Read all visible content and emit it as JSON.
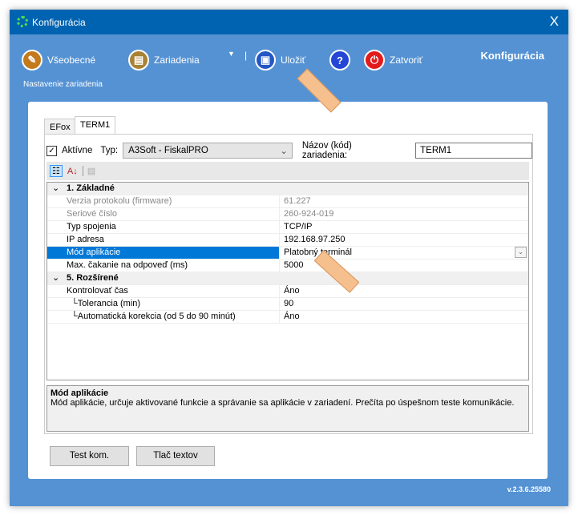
{
  "window": {
    "title": "Konfigurácia",
    "close": "X"
  },
  "toolbar": {
    "general": "Všeobecné",
    "devices": "Zariadenia",
    "save": "Uložiť",
    "help": "?",
    "close": "Zatvoriť",
    "header": "Konfigurácia",
    "subtitle": "Nastavenie zariadenia"
  },
  "tabs": [
    "EFox",
    "TERM1"
  ],
  "device": {
    "active_label": "Aktívne",
    "type_label": "Typ:",
    "type_value": "A3Soft - FiskalPRO",
    "name_label": "Názov (kód) zariadenia:",
    "name_value": "TERM1"
  },
  "grid": {
    "cat1": "1. Základné",
    "rows1": [
      {
        "name": "Verzia protokolu (firmware)",
        "value": "61.227"
      },
      {
        "name": "Seriové číslo",
        "value": "260-924-019"
      },
      {
        "name": "Typ spojenia",
        "value": "TCP/IP"
      },
      {
        "name": "IP adresa",
        "value": "192.168.97.250"
      },
      {
        "name": "Mód aplikácie",
        "value": "Platobný terminál"
      },
      {
        "name": "Max. čakanie na odpoveď (ms)",
        "value": "5000"
      }
    ],
    "cat2": "5. Rozšírené",
    "rows2": [
      {
        "name": "Kontrolovať čas",
        "value": "Áno"
      },
      {
        "name": "└Tolerancia (min)",
        "value": "90"
      },
      {
        "name": "└Automatická korekcia (od 5 do 90 minút)",
        "value": "Áno"
      }
    ]
  },
  "description": {
    "title": "Mód aplikácie",
    "text": "Mód aplikácie, určuje aktivované funkcie a správanie sa aplikácie v zariadení. Prečíta po úspešnom teste komunikácie."
  },
  "buttons": {
    "test": "Test kom.",
    "print": "Tlač textov"
  },
  "version": "v.2.3.6.25580"
}
